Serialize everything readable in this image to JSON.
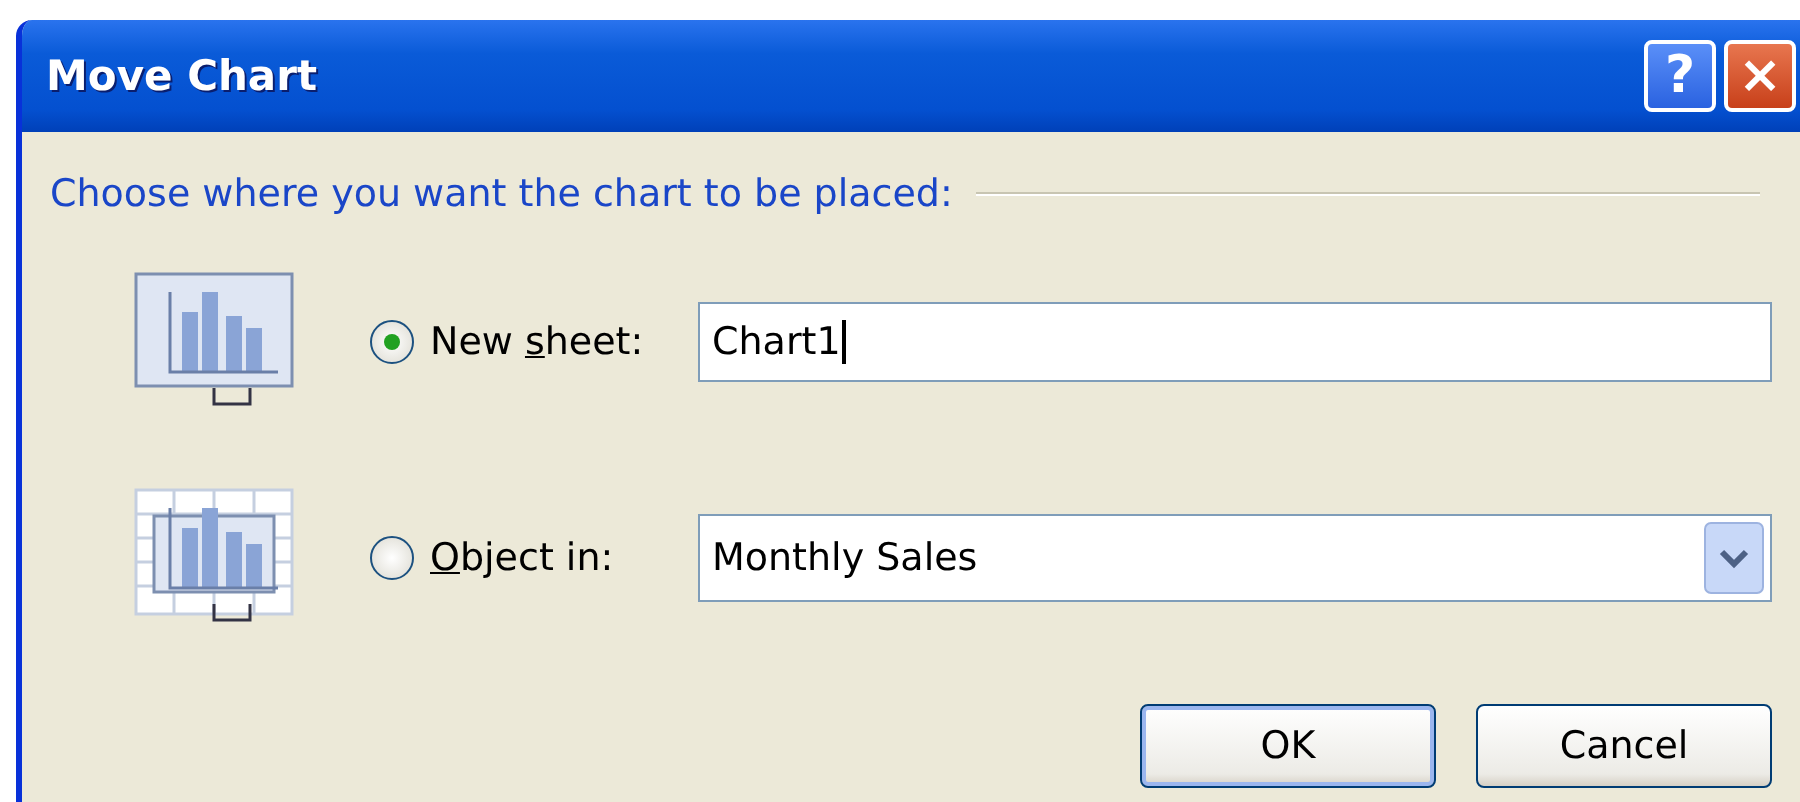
{
  "window": {
    "title": "Move Chart",
    "help_button": "?",
    "close_button": "×"
  },
  "group_label": "Choose where you want the chart to be placed:",
  "options": [
    {
      "kind": "text",
      "label_before": "New ",
      "access_key": "s",
      "label_after": "heet:",
      "selected": true,
      "value": "Chart1"
    },
    {
      "kind": "dropdown",
      "access_key": "O",
      "label_after": "bject in:",
      "selected": false,
      "value": "Monthly Sales"
    }
  ],
  "buttons": [
    "OK",
    "Cancel"
  ]
}
